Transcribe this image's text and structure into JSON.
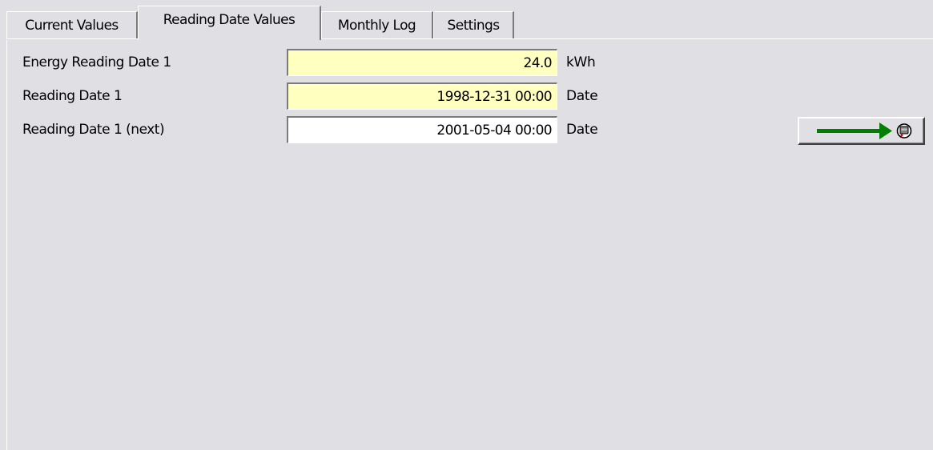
{
  "tabs": [
    {
      "label": "Current Values",
      "active": false
    },
    {
      "label": "Reading Date Values",
      "active": true
    },
    {
      "label": "Monthly Log",
      "active": false
    },
    {
      "label": "Settings",
      "active": false
    }
  ],
  "rows": [
    {
      "label": "Energy Reading Date 1",
      "value": "24.0",
      "unit": "kWh",
      "field_color": "#ffffc0"
    },
    {
      "label": "Reading Date 1",
      "value": "1998-12-31 00:00",
      "unit": "Date",
      "field_color": "#ffffc0"
    },
    {
      "label": "Reading Date 1 (next)",
      "value": "2001-05-04 00:00",
      "unit": "Date",
      "field_color": "#ffffff"
    }
  ],
  "send_button": {
    "icon": "arrow-to-meter-icon",
    "arrow_color": "#008000"
  }
}
